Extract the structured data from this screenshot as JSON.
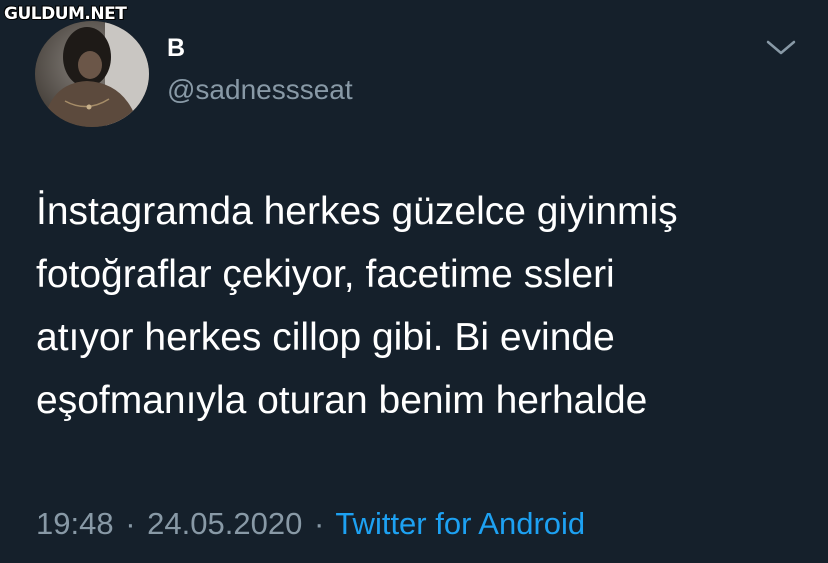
{
  "watermark": "GULDUM.NET",
  "tweet": {
    "display_name": "B",
    "handle": "@sadnessseat",
    "text_lines": [
      "İnstagramda herkes güzelce giyinmiş",
      "fotoğraflar çekiyor, facetime ssleri",
      "atıyor herkes cillop gibi. Bi evinde",
      "eşofmanıyla oturan benim herhalde"
    ],
    "time": "19:48",
    "date": "24.05.2020",
    "separator": "·",
    "source": "Twitter for Android"
  },
  "icons": {
    "menu": "chevron-down-icon",
    "avatar": "profile-photo"
  },
  "colors": {
    "background": "#15202b",
    "text": "#ffffff",
    "secondary_text": "#8899a6",
    "link": "#1da1f2"
  }
}
